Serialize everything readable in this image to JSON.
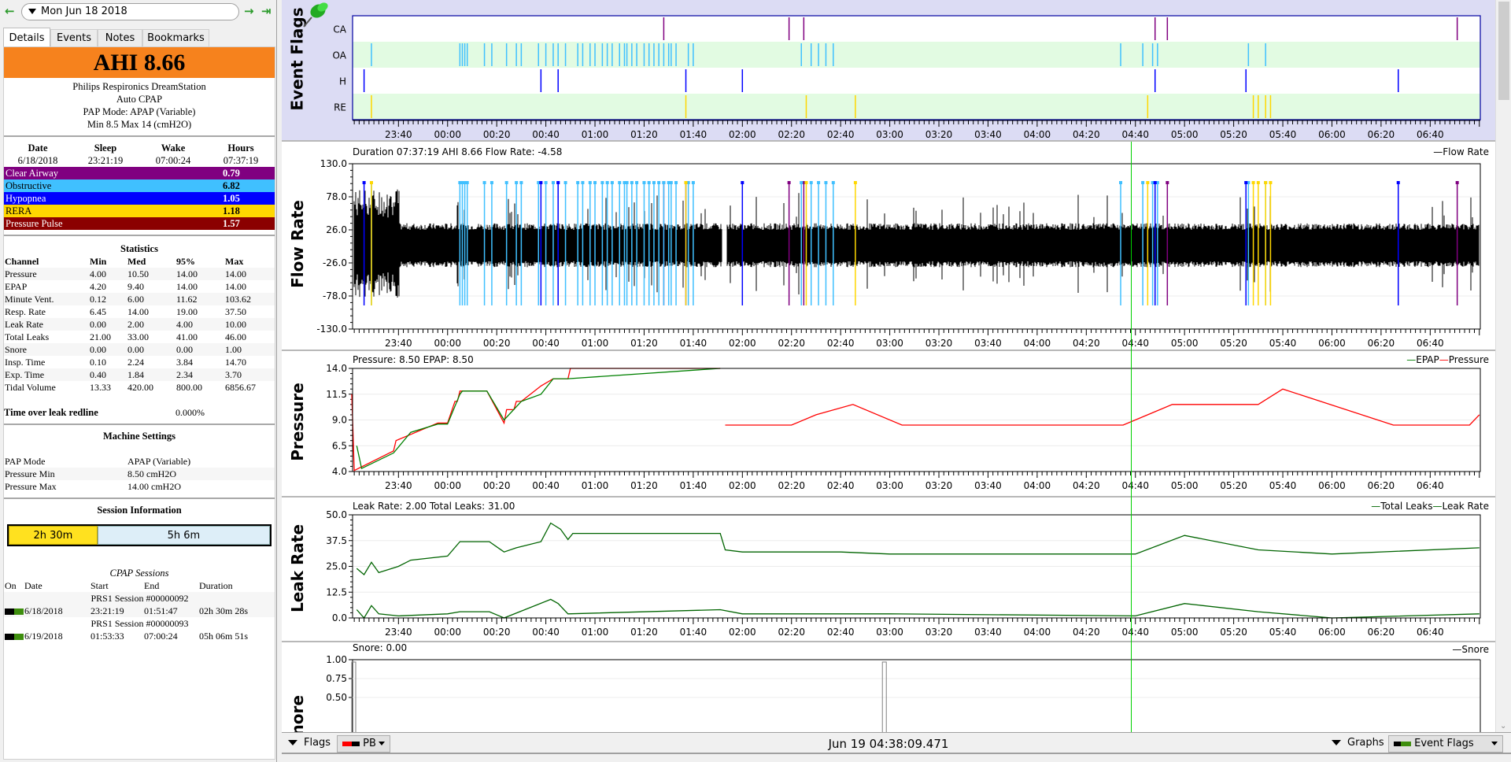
{
  "nav": {
    "date": "Mon Jun 18 2018",
    "back_icon": "arrow-left",
    "forward_icon": "arrow-right",
    "last_icon": "arrow-to-end"
  },
  "tabs": [
    {
      "label": "Details",
      "active": true
    },
    {
      "label": "Events",
      "active": false
    },
    {
      "label": "Notes",
      "active": false
    },
    {
      "label": "Bookmarks",
      "active": false
    }
  ],
  "summary": {
    "ahi": "AHI 8.66",
    "ahi_color": "#f6821d",
    "machine": "Philips Respironics DreamStation",
    "type": "Auto CPAP",
    "mode_line": "PAP Mode: APAP (Variable)",
    "pressure_line": "Min 8.5 Max 14 (cmH2O)"
  },
  "sleep": {
    "headers": [
      "Date",
      "Sleep",
      "Wake",
      "Hours"
    ],
    "values": [
      "6/18/2018",
      "23:21:19",
      "07:00:24",
      "07:37:19"
    ]
  },
  "events": [
    {
      "label": "Clear Airway",
      "value": "0.79",
      "color": "#800080",
      "text": "#ffffff"
    },
    {
      "label": "Obstructive",
      "value": "6.82",
      "color": "#40c0ff",
      "text": "#000000"
    },
    {
      "label": "Hypopnea",
      "value": "1.05",
      "color": "#0000ff",
      "text": "#ffffff"
    },
    {
      "label": "RERA",
      "value": "1.18",
      "color": "#ffd700",
      "text": "#000000"
    },
    {
      "label": "Pressure Pulse",
      "value": "1.57",
      "color": "#8b0000",
      "text": "#ffffff"
    }
  ],
  "statistics": {
    "title": "Statistics",
    "headers": [
      "Channel",
      "Min",
      "Med",
      "95%",
      "Max"
    ],
    "rows": [
      [
        "Pressure",
        "4.00",
        "10.50",
        "14.00",
        "14.00"
      ],
      [
        "EPAP",
        "4.20",
        "9.40",
        "14.00",
        "14.00"
      ],
      [
        "Minute Vent.",
        "0.12",
        "6.00",
        "11.62",
        "103.62"
      ],
      [
        "Resp. Rate",
        "6.45",
        "14.00",
        "19.00",
        "37.50"
      ],
      [
        "Leak Rate",
        "0.00",
        "2.00",
        "4.00",
        "10.00"
      ],
      [
        "Total Leaks",
        "21.00",
        "33.00",
        "41.00",
        "46.00"
      ],
      [
        "Snore",
        "0.00",
        "0.00",
        "0.00",
        "1.00"
      ],
      [
        "Insp. Time",
        "0.10",
        "2.24",
        "3.84",
        "14.70"
      ],
      [
        "Exp. Time",
        "0.40",
        "1.84",
        "2.34",
        "3.70"
      ],
      [
        "Tidal Volume",
        "13.33",
        "420.00",
        "800.00",
        "6856.67"
      ]
    ],
    "leak_redline_label": "Time over leak redline",
    "leak_redline_value": "0.000%"
  },
  "machine_settings": {
    "title": "Machine Settings",
    "rows": [
      [
        "PAP Mode",
        "APAP (Variable)"
      ],
      [
        "Pressure Min",
        "8.50 cmH2O"
      ],
      [
        "Pressure Max",
        "14.00 cmH2O"
      ]
    ]
  },
  "session_info": {
    "title": "Session Information",
    "bar": [
      {
        "label": "2h 30m",
        "fraction": 0.33
      },
      {
        "label": "5h 6m",
        "fraction": 0.67
      }
    ],
    "cpap_title": "CPAP Sessions",
    "headers": [
      "On",
      "Date",
      "Start",
      "End",
      "Duration"
    ],
    "sessions": [
      {
        "name": "PRS1 Session #00000092",
        "date": "6/18/2018",
        "start": "23:21:19",
        "end": "01:51:47",
        "duration": "02h 30m 28s"
      },
      {
        "name": "PRS1 Session #00000093",
        "date": "6/19/2018",
        "start": "01:53:33",
        "end": "07:00:24",
        "duration": "05h 06m 51s"
      }
    ]
  },
  "time_axis": {
    "start": "23:21:19",
    "end": "07:00:24",
    "ticks": [
      "23:40",
      "00:00",
      "00:20",
      "00:40",
      "01:00",
      "01:20",
      "01:40",
      "02:00",
      "02:20",
      "02:40",
      "03:00",
      "03:20",
      "03:40",
      "04:00",
      "04:20",
      "04:40",
      "05:00",
      "05:20",
      "05:40",
      "06:00",
      "06:20",
      "06:40"
    ],
    "cursor_time": "04:38"
  },
  "event_flags": {
    "title": "Event Flags",
    "rows": [
      {
        "label": "CA",
        "color": "#800080",
        "times": [
          "01:28",
          "02:19",
          "02:25",
          "04:48",
          "04:53",
          "06:51"
        ]
      },
      {
        "label": "OA",
        "color": "#40c0ff",
        "times": [
          "23:29",
          "00:05",
          "00:06",
          "00:07",
          "00:08",
          "00:15",
          "00:18",
          "00:24",
          "00:28",
          "00:30",
          "00:37",
          "00:40",
          "00:43",
          "00:45",
          "00:48",
          "00:53",
          "00:55",
          "00:58",
          "01:00",
          "01:03",
          "01:05",
          "01:07",
          "01:10",
          "01:12",
          "01:13",
          "01:15",
          "01:17",
          "01:20",
          "01:22",
          "01:24",
          "01:26",
          "01:28",
          "01:30",
          "01:31",
          "01:33",
          "01:38",
          "01:40",
          "02:24",
          "02:28",
          "02:31",
          "02:34",
          "02:37",
          "04:34",
          "04:43",
          "04:47",
          "04:49",
          "05:26",
          "05:33"
        ]
      },
      {
        "label": "H",
        "color": "#0000ff",
        "times": [
          "23:26",
          "00:38",
          "00:45",
          "01:37",
          "02:00",
          "04:48",
          "05:25",
          "06:27"
        ]
      },
      {
        "label": "RE",
        "color": "#ffd700",
        "times": [
          "23:29",
          "01:37",
          "02:26",
          "02:46",
          "04:45",
          "05:28",
          "05:30",
          "05:33",
          "05:35"
        ]
      }
    ]
  },
  "flow_rate": {
    "ylabel": "Flow Rate",
    "title": "Duration 07:37:19 AHI 8.66 Flow Rate: -4.58",
    "legend": "Flow Rate",
    "yticks": [
      "130.0",
      "78.0",
      "26.0",
      "-26.0",
      "-78.0",
      "-130.0"
    ],
    "ylim": [
      -130,
      130
    ]
  },
  "pressure": {
    "ylabel": "Pressure",
    "title": "Pressure: 8.50 EPAP: 8.50",
    "legend": [
      {
        "label": "EPAP",
        "color": "#008000"
      },
      {
        "label": "Pressure",
        "color": "#ff0000"
      }
    ],
    "yticks": [
      "14.0",
      "11.5",
      "9.0",
      "6.5",
      "4.0"
    ],
    "ylim": [
      4,
      14
    ]
  },
  "leak_rate": {
    "ylabel": "Leak Rate",
    "title": "Leak Rate: 2.00 Total Leaks: 31.00",
    "legend": [
      {
        "label": "Total Leaks",
        "color": "#006400"
      },
      {
        "label": "Leak Rate",
        "color": "#006400"
      }
    ],
    "yticks": [
      "50.0",
      "37.5",
      "25.0",
      "12.5",
      "0.0"
    ],
    "ylim": [
      0,
      50
    ]
  },
  "snore": {
    "ylabel": "Snore",
    "title": "Snore: 0.00",
    "legend": "Snore",
    "yticks": [
      "1.00",
      "0.75",
      "0.50"
    ],
    "ylim": [
      0,
      1
    ]
  },
  "chart_data": [
    {
      "type": "line",
      "title": "Pressure",
      "ylim": [
        4,
        14
      ],
      "series": [
        {
          "name": "Pressure",
          "x": [
            "23:21",
            "23:22",
            "23:38",
            "23:39",
            "23:56",
            "00:00",
            "00:03",
            "00:04",
            "00:05",
            "00:16",
            "00:23",
            "00:24",
            "00:27",
            "00:28",
            "00:30",
            "00:38",
            "00:43",
            "00:49",
            "00:50",
            "01:51"
          ],
          "values": [
            11.5,
            4.1,
            6.0,
            7.0,
            8.7,
            8.7,
            10.8,
            10.8,
            11.8,
            11.8,
            8.7,
            10.0,
            10.0,
            10.8,
            10.8,
            12.3,
            13.0,
            13.0,
            14.0,
            14.0
          ]
        },
        {
          "name": "EPAP",
          "x": [
            "23:23",
            "23:25",
            "23:38",
            "23:45",
            "23:56",
            "00:00",
            "00:05",
            "00:06",
            "00:16",
            "00:23",
            "00:30",
            "00:38",
            "00:43",
            "00:49",
            "01:51"
          ],
          "values": [
            6.5,
            4.3,
            5.8,
            7.8,
            8.6,
            8.6,
            11.5,
            11.8,
            11.8,
            9.0,
            10.8,
            11.5,
            13.0,
            13.0,
            14.0
          ]
        },
        {
          "name": "Pressure (session 2)",
          "x": [
            "01:53",
            "02:20",
            "02:30",
            "02:45",
            "03:05",
            "03:40",
            "04:35",
            "04:45",
            "04:55",
            "05:30",
            "05:40",
            "06:25",
            "06:56",
            "07:00"
          ],
          "values": [
            8.5,
            8.5,
            9.5,
            10.5,
            8.5,
            8.5,
            8.5,
            9.5,
            10.5,
            10.5,
            12.0,
            8.5,
            8.5,
            9.5
          ]
        }
      ]
    },
    {
      "type": "line",
      "title": "Leak Rate",
      "ylim": [
        0,
        50
      ],
      "series": [
        {
          "name": "Total Leaks",
          "x": [
            "23:23",
            "23:26",
            "23:29",
            "23:32",
            "23:40",
            "23:45",
            "00:00",
            "00:05",
            "00:17",
            "00:23",
            "00:28",
            "00:38",
            "00:42",
            "00:46",
            "00:49",
            "00:51",
            "01:51",
            "01:53",
            "02:00",
            "02:40",
            "03:00",
            "04:40",
            "05:00",
            "05:30",
            "06:00",
            "07:00"
          ],
          "values": [
            24,
            21,
            27,
            22,
            25,
            28,
            30,
            37,
            37,
            32,
            34,
            37,
            46,
            43,
            38,
            41,
            41,
            33,
            32,
            32,
            31,
            31,
            40,
            33,
            31,
            34
          ]
        },
        {
          "name": "Leak Rate",
          "x": [
            "23:23",
            "23:26",
            "23:29",
            "23:32",
            "23:40",
            "00:00",
            "00:05",
            "00:17",
            "00:23",
            "00:42",
            "00:45",
            "00:49",
            "01:51",
            "02:00",
            "03:00",
            "04:40",
            "05:00",
            "05:30",
            "06:00",
            "07:00"
          ],
          "values": [
            4,
            0,
            6,
            2,
            1,
            2,
            3,
            3,
            0,
            9,
            7,
            2,
            4,
            2,
            2,
            1,
            7,
            3,
            0,
            2
          ]
        }
      ]
    },
    {
      "type": "line",
      "title": "Snore",
      "ylim": [
        0,
        1
      ],
      "series": [
        {
          "name": "Snore",
          "x": [
            "23:21",
            "23:22",
            "02:57",
            "02:58",
            "07:00"
          ],
          "values": [
            1,
            0,
            1,
            0,
            0
          ]
        }
      ]
    }
  ],
  "bottom": {
    "flags_label": "Flags",
    "flags_select": "PB",
    "datetime": "Jun 19 04:38:09.471",
    "graphs_label": "Graphs",
    "graphs_select": "Event Flags"
  }
}
